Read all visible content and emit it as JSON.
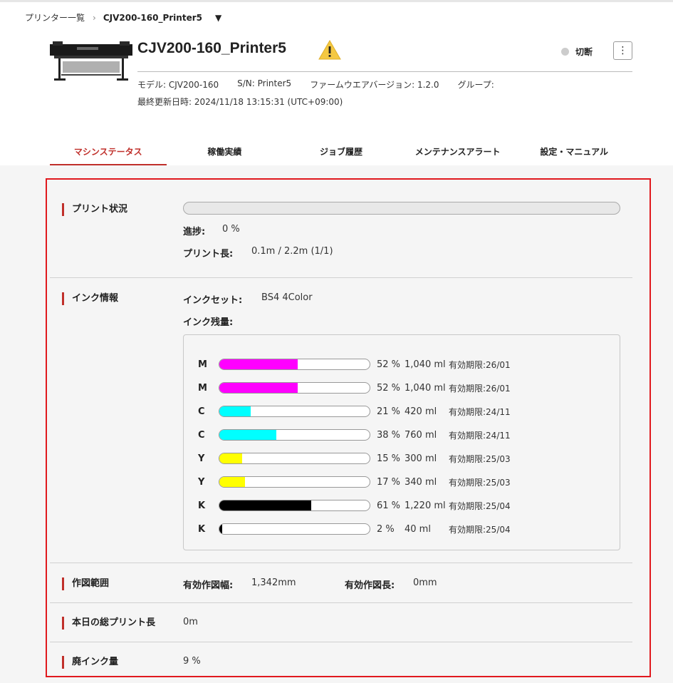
{
  "breadcrumb": {
    "parent": "プリンター一覧",
    "current": "CJV200-160_Printer5"
  },
  "header": {
    "title": "CJV200-160_Printer5",
    "status": "切断",
    "model": "モデル: CJV200-160",
    "serial": "S/N: Printer5",
    "firmware": "ファームウエアバージョン: 1.2.0",
    "group": "グループ:",
    "updated": "最終更新日時: 2024/11/18 13:15:31 (UTC+09:00)"
  },
  "tabs": [
    "マシンステータス",
    "稼働実績",
    "ジョブ履歴",
    "メンテナンスアラート",
    "設定・マニュアル"
  ],
  "print_status": {
    "label": "プリント状況",
    "progress_label": "進捗:",
    "progress_value": "0 %",
    "progress_fraction": 0,
    "length_label": "プリント長:",
    "length_value": "0.1m / 2.2m (1/1)"
  },
  "ink_info": {
    "label": "インク情報",
    "inkset_label": "インクセット:",
    "inkset_value": "BS4 4Color",
    "remaining_label": "インク残量:",
    "inks": [
      {
        "color": "M",
        "percent": "52 %",
        "volume": "1,040 ml",
        "expiry": "有効期限:26/01",
        "level": 0.52,
        "hex": "#ff00ff"
      },
      {
        "color": "M",
        "percent": "52 %",
        "volume": "1,040 ml",
        "expiry": "有効期限:26/01",
        "level": 0.52,
        "hex": "#ff00ff"
      },
      {
        "color": "C",
        "percent": "21 %",
        "volume": "420 ml",
        "expiry": "有効期限:24/11",
        "level": 0.21,
        "hex": "#00ffff"
      },
      {
        "color": "C",
        "percent": "38 %",
        "volume": "760 ml",
        "expiry": "有効期限:24/11",
        "level": 0.38,
        "hex": "#00ffff"
      },
      {
        "color": "Y",
        "percent": "15 %",
        "volume": "300 ml",
        "expiry": "有効期限:25/03",
        "level": 0.15,
        "hex": "#ffff00"
      },
      {
        "color": "Y",
        "percent": "17 %",
        "volume": "340 ml",
        "expiry": "有効期限:25/03",
        "level": 0.17,
        "hex": "#ffff00"
      },
      {
        "color": "K",
        "percent": "61 %",
        "volume": "1,220 ml",
        "expiry": "有効期限:25/04",
        "level": 0.61,
        "hex": "#000000"
      },
      {
        "color": "K",
        "percent": "2 %",
        "volume": "40 ml",
        "expiry": "有効期限:25/04",
        "level": 0.02,
        "hex": "#000000"
      }
    ]
  },
  "plot_area": {
    "label": "作図範囲",
    "width_label": "有効作図幅:",
    "width_value": "1,342mm",
    "length_label": "有効作図長:",
    "length_value": "0mm"
  },
  "daily": {
    "label": "本日の総プリント長",
    "value": "0m"
  },
  "waste": {
    "label": "廃インク量",
    "value": "9 %"
  },
  "colors": {
    "accent": "#c0302b",
    "highlight_border": "#e0191e",
    "warning": "#f4c842"
  }
}
